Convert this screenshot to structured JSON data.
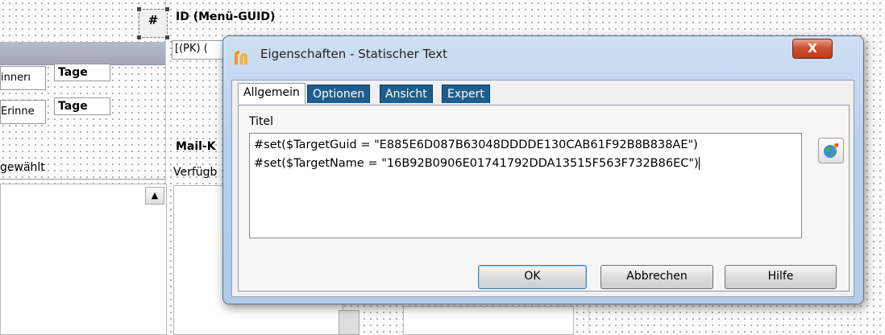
{
  "background": {
    "hash_label": "#",
    "id_header": "ID (Menü-GUID)",
    "pk_field": "[(PK) (",
    "row1_text": "innerı",
    "row1_tage": "Tage",
    "row2_text": "Erinne",
    "row2_tage": "Tage",
    "mail_label": "Mail-K",
    "verfueg_label": "Verfügb",
    "selected_label": "gewählt",
    "scroll_up_glyph": "▲"
  },
  "dialog": {
    "title": "Eigenschaften - Statischer Text",
    "close_glyph": "X",
    "tabs": [
      {
        "label": "Allgemein",
        "active": true
      },
      {
        "label": "Optionen",
        "active": false
      },
      {
        "label": "Ansicht",
        "active": false
      },
      {
        "label": "Expert",
        "active": false
      }
    ],
    "titel_label": "Titel",
    "text_lines": [
      "#set($TargetGuid = \"E885E6D087B63048DDDDE130CAB61F92B8B838AE\")",
      "#set($TargetName = \"16B92B0906E01741792DDA13515F563F732B86EC\")"
    ],
    "buttons": {
      "ok": "OK",
      "cancel": "Abbrechen",
      "help": "Hilfe"
    },
    "icons": {
      "app": "app-logo-icon",
      "side": "expression-editor-icon"
    },
    "colors": {
      "tab_inactive": "#1d5e8e",
      "close_red": "#c13b17",
      "title_bar": "#b9d0ea"
    }
  }
}
